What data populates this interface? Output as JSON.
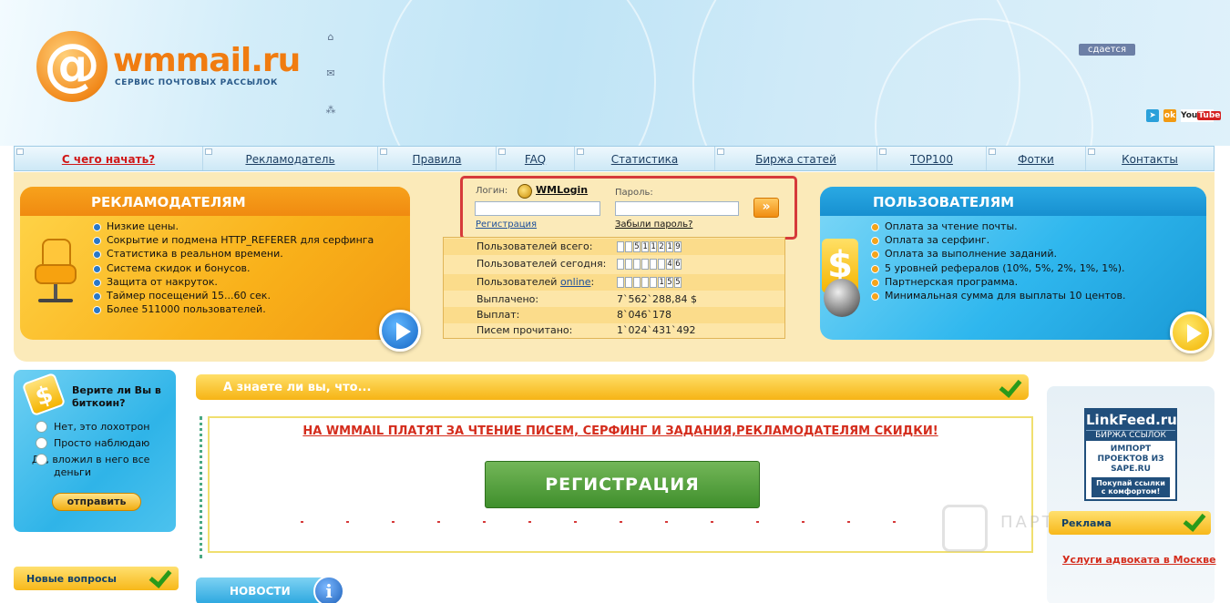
{
  "header": {
    "logo_at": "@",
    "logo_name": "wmmail.ru",
    "logo_tagline": "СЕРВИС ПОЧТОВЫХ РАССЫЛОК",
    "rent_badge": "сдается",
    "icons": [
      "home-icon",
      "mail-icon",
      "sitemap-icon"
    ],
    "social": [
      "telegram",
      "odnoklassniki",
      "YouTube"
    ]
  },
  "nav": [
    "С чего начать?",
    "Рекламодатель",
    "Правила",
    "FAQ",
    "Статистика",
    "Биржа статей",
    "TOP100",
    "Фотки",
    "Контакты"
  ],
  "advertisers": {
    "title": "РЕКЛАМОДАТЕЛЯМ",
    "items": [
      "Низкие цены.",
      "Сокрытие и подмена HTTP_REFERER для серфинга",
      "Статистика в реальном времени.",
      "Система скидок и бонусов.",
      "Защита от накруток.",
      "Таймер посещений 15...60 сек.",
      "Более 511000 пользователей."
    ]
  },
  "users": {
    "title": "ПОЛЬЗОВАТЕЛЯМ",
    "items": [
      "Оплата за чтение почты.",
      "Оплата за серфинг.",
      "Оплата за выполнение заданий.",
      "5 уровней рефералов (10%, 5%, 2%, 1%, 1%).",
      "Партнерская программа.",
      "Минимальная сумма для выплаты 10 центов."
    ]
  },
  "login": {
    "login_label": "Логин:",
    "wmlogin": "WMLogin",
    "password_label": "Пароль:",
    "register_link": "Регистрация",
    "forgot_link": "Забыли пароль?",
    "go_button": "»"
  },
  "stats": {
    "total_label": "Пользователей всего:",
    "total_digits": [
      "",
      "",
      "5",
      "1",
      "1",
      "2",
      "1",
      "9"
    ],
    "today_label": "Пользователей сегодня:",
    "today_digits": [
      "",
      "",
      "",
      "",
      "",
      "",
      "4",
      "6"
    ],
    "online_prefix": "Пользователей ",
    "online_link": "online",
    "online_suffix": ":",
    "online_digits": [
      "",
      "",
      "",
      "",
      "",
      "1",
      "5",
      "5"
    ],
    "paid_label": "Выплачено:",
    "paid_value": "7`562`288,84 $",
    "payout_label": "Выплат:",
    "payout_value": "8`046`178",
    "read_label": "Писем прочитано:",
    "read_value": "1`024`431`492"
  },
  "poll": {
    "question": "Верите ли Вы в биткоин?",
    "options": [
      "Нет, это лохотрон",
      "Просто наблюдаю",
      "Да, вложил в него все деньги"
    ],
    "submit": "отправить"
  },
  "sidebar": {
    "new_questions": "Новые вопросы"
  },
  "main": {
    "did_you_know": "А знаете ли вы, что...",
    "promo": "НА WMMAIL ПЛАТЯТ ЗА ЧТЕНИЕ ПИСЕМ, СЕРФИНГ И ЗАДАНИЯ,РЕКЛАМОДАТЕЛЯМ СКИДКИ!",
    "register_button": "РЕГИСТРАЦИЯ",
    "news": "НОВОСТИ"
  },
  "right": {
    "linkfeed_title": "LinkFeed.ru",
    "linkfeed_sub": "БИРЖА ССЫЛОК",
    "linkfeed_text": "ИМПОРТ ПРОЕКТОВ ИЗ SAPE.RU",
    "linkfeed_bottom": "Покупай ссылки с комфортом!",
    "ads_title": "Реклама",
    "ads_link": "Услуги адвоката в Москве"
  },
  "watermark": "ПАРТНЕРКИН",
  "colors": {
    "accent_orange": "#f28a1c",
    "accent_blue": "#2fb7ee",
    "link_red": "#d42c1c",
    "highlight_border": "#d63a3a"
  }
}
